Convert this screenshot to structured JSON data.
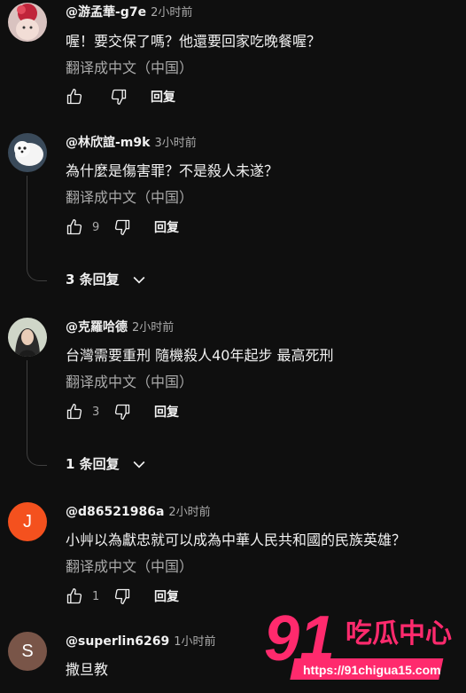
{
  "labels": {
    "translate": "翻译成中文（中国）",
    "reply": "回复"
  },
  "colors": {
    "background": "#0f0f0f",
    "watermark_pink": "#ff2a6d"
  },
  "comments": [
    {
      "author": "@游孟華-g7e",
      "time": "2小时前",
      "text": "喔！要交保了嗎？他還要回家吃晚餐喔？",
      "likes": "",
      "avatar_icon": "photo-avatar-red"
    },
    {
      "author": "@林欣誼-m9k",
      "time": "3小时前",
      "text": "為什麼是傷害罪？不是殺人未遂？",
      "likes": "9",
      "replies": "3 条回复",
      "avatar_icon": "photo-avatar-dog"
    },
    {
      "author": "@克羅哈德",
      "time": "2小时前",
      "text": "台灣需要重刑 隨機殺人40年起步 最高死刑",
      "likes": "3",
      "replies": "1 条回复",
      "avatar_icon": "photo-avatar-portrait"
    },
    {
      "author": "@d86521986a",
      "time": "2小时前",
      "text": "小艸以為獻忠就可以成為中華人民共和國的民族英雄？",
      "likes": "1",
      "avatar_letter": "J",
      "avatar_color": "#f4511e"
    },
    {
      "author": "@superlin6269",
      "time": "1小时前",
      "text": "撒旦教",
      "avatar_letter": "S",
      "avatar_color": "#795548"
    }
  ],
  "watermark": {
    "brand": "91",
    "brand_text": "吃瓜中心",
    "url": "https://91chigua15.com"
  }
}
